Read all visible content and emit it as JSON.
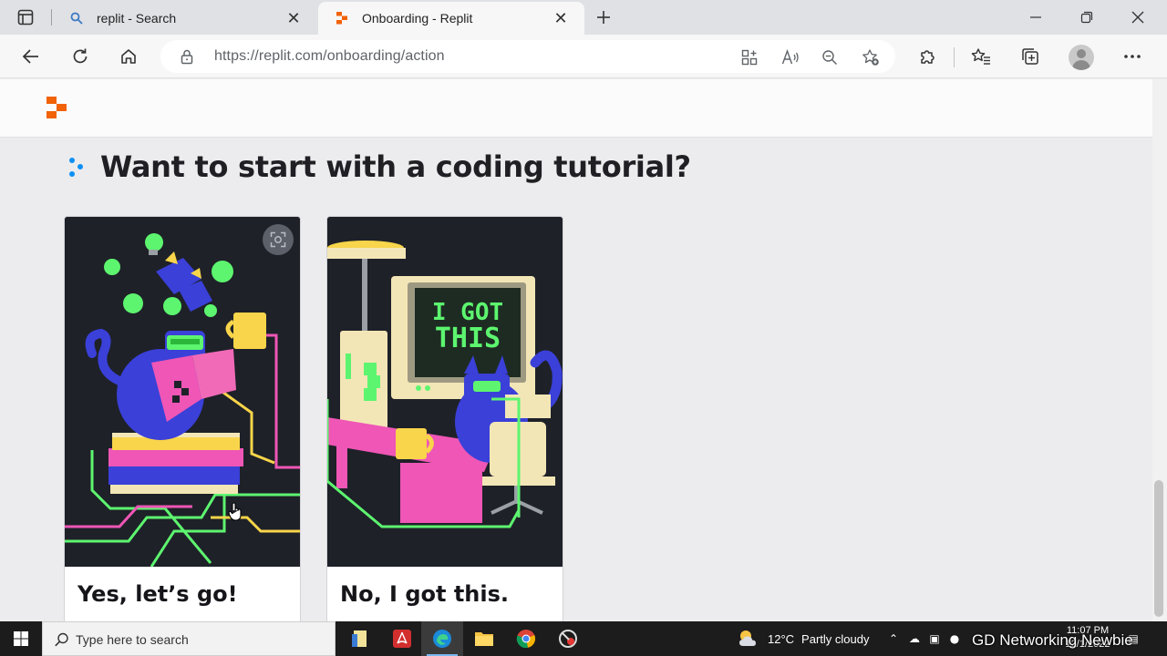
{
  "browser": {
    "tabs": [
      {
        "title": "replit - Search"
      },
      {
        "title": "Onboarding - Replit"
      }
    ],
    "url": "https://replit.com/onboarding/action"
  },
  "page": {
    "heading": "Want to start with a coding tutorial?",
    "cards": [
      {
        "label": "Yes, let’s go!",
        "illustration": "cat-reading-book-illustration"
      },
      {
        "label": "No, I got this.",
        "illustration": "cat-at-computer-illustration",
        "screen_text_line1": "I GOT",
        "screen_text_line2": "THIS"
      }
    ]
  },
  "taskbar": {
    "search_placeholder": "Type here to search",
    "weather_temp": "12°C",
    "weather_desc": "Partly cloudy",
    "time": "11:07 PM",
    "date": "12/1/2022"
  },
  "watermark": "GD Networking Newbie",
  "colors": {
    "replit_orange": "#f26207",
    "illustration_bg": "#1e2128",
    "accent_green": "#5df56f",
    "accent_pink": "#ef56b6",
    "accent_purple": "#3a40d8",
    "accent_yellow": "#f8d54a"
  }
}
